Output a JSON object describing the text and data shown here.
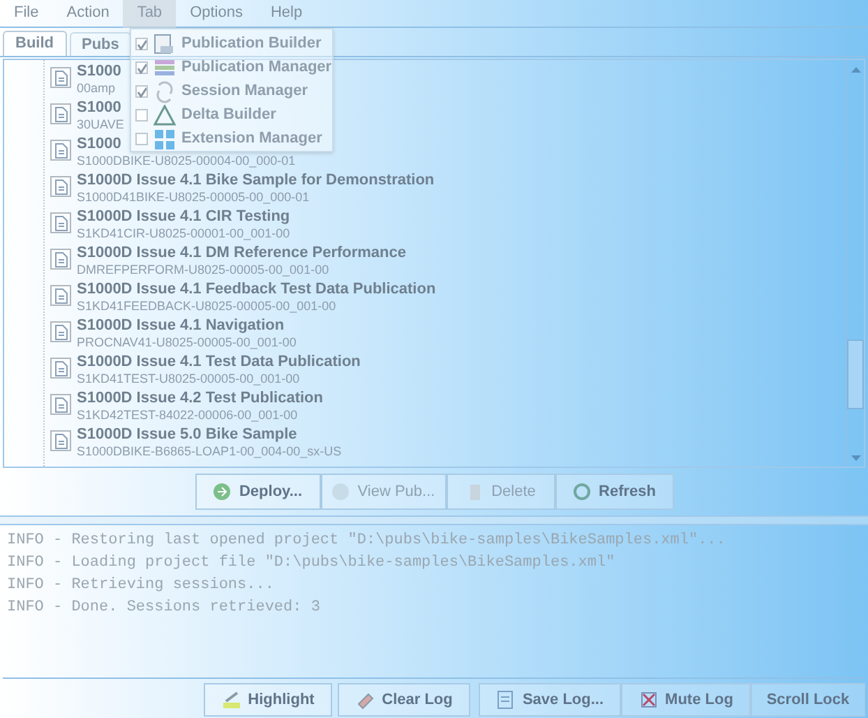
{
  "menu_bar": [
    {
      "label": "File",
      "selected": false
    },
    {
      "label": "Action",
      "selected": false
    },
    {
      "label": "Tab",
      "selected": true
    },
    {
      "label": "Options",
      "selected": false
    },
    {
      "label": "Help",
      "selected": false
    }
  ],
  "tab_menu": [
    {
      "label": "Publication Builder",
      "checked": true,
      "kind": "builder"
    },
    {
      "label": "Publication Manager",
      "checked": true,
      "kind": "manager"
    },
    {
      "label": "Session Manager",
      "checked": true,
      "kind": "session"
    },
    {
      "label": "Delta Builder",
      "checked": false,
      "kind": "delta"
    },
    {
      "label": "Extension Manager",
      "checked": false,
      "kind": "extension"
    }
  ],
  "tabs": [
    {
      "label": "Build",
      "selected": true
    },
    {
      "label": "Pubs",
      "selected": false
    }
  ],
  "publications": [
    {
      "title": "S1000",
      "code": "00amp"
    },
    {
      "title": "S1000",
      "code": "30UAVE"
    },
    {
      "title": "S1000",
      "code": "S1000DBIKE-U8025-00004-00_000-01"
    },
    {
      "title": "S1000D Issue 4.1 Bike Sample for Demonstration",
      "code": "S1000D41BIKE-U8025-00005-00_000-01"
    },
    {
      "title": "S1000D Issue 4.1 CIR Testing",
      "code": "S1KD41CIR-U8025-00001-00_001-00"
    },
    {
      "title": "S1000D Issue 4.1 DM Reference Performance",
      "code": "DMREFPERFORM-U8025-00005-00_001-00"
    },
    {
      "title": "S1000D Issue 4.1 Feedback Test Data Publication",
      "code": "S1KD41FEEDBACK-U8025-00005-00_001-00"
    },
    {
      "title": "S1000D Issue 4.1 Navigation",
      "code": "PROCNAV41-U8025-00005-00_001-00"
    },
    {
      "title": "S1000D Issue 4.1 Test Data Publication",
      "code": "S1KD41TEST-U8025-00005-00_001-00"
    },
    {
      "title": "S1000D Issue 4.2 Test Publication",
      "code": "S1KD42TEST-84022-00006-00_001-00"
    },
    {
      "title": "S1000D Issue 5.0 Bike Sample",
      "code": "S1000DBIKE-B6865-LOAP1-00_004-00_sx-US"
    }
  ],
  "pub_buttons": [
    {
      "label": "Deploy...",
      "disabled": false,
      "kind": "deploy"
    },
    {
      "label": "View Pub...",
      "disabled": true,
      "kind": "view"
    },
    {
      "label": "Delete",
      "disabled": true,
      "kind": "delete"
    },
    {
      "label": "Refresh",
      "disabled": false,
      "kind": "refresh"
    }
  ],
  "log": [
    "INFO - Restoring last opened project \"D:\\pubs\\bike-samples\\BikeSamples.xml\"...",
    "INFO - Loading project file \"D:\\pubs\\bike-samples\\BikeSamples.xml\"",
    "INFO - Retrieving sessions...",
    "INFO - Done. Sessions retrieved: 3"
  ],
  "log_buttons": [
    {
      "label": "Highlight",
      "kind": "highlight"
    },
    {
      "label": "Clear Log",
      "kind": "clear"
    },
    {
      "label": "Save Log...",
      "kind": "save"
    },
    {
      "label": "Mute Log",
      "kind": "mute"
    },
    {
      "label": "Scroll Lock",
      "kind": "none"
    }
  ]
}
